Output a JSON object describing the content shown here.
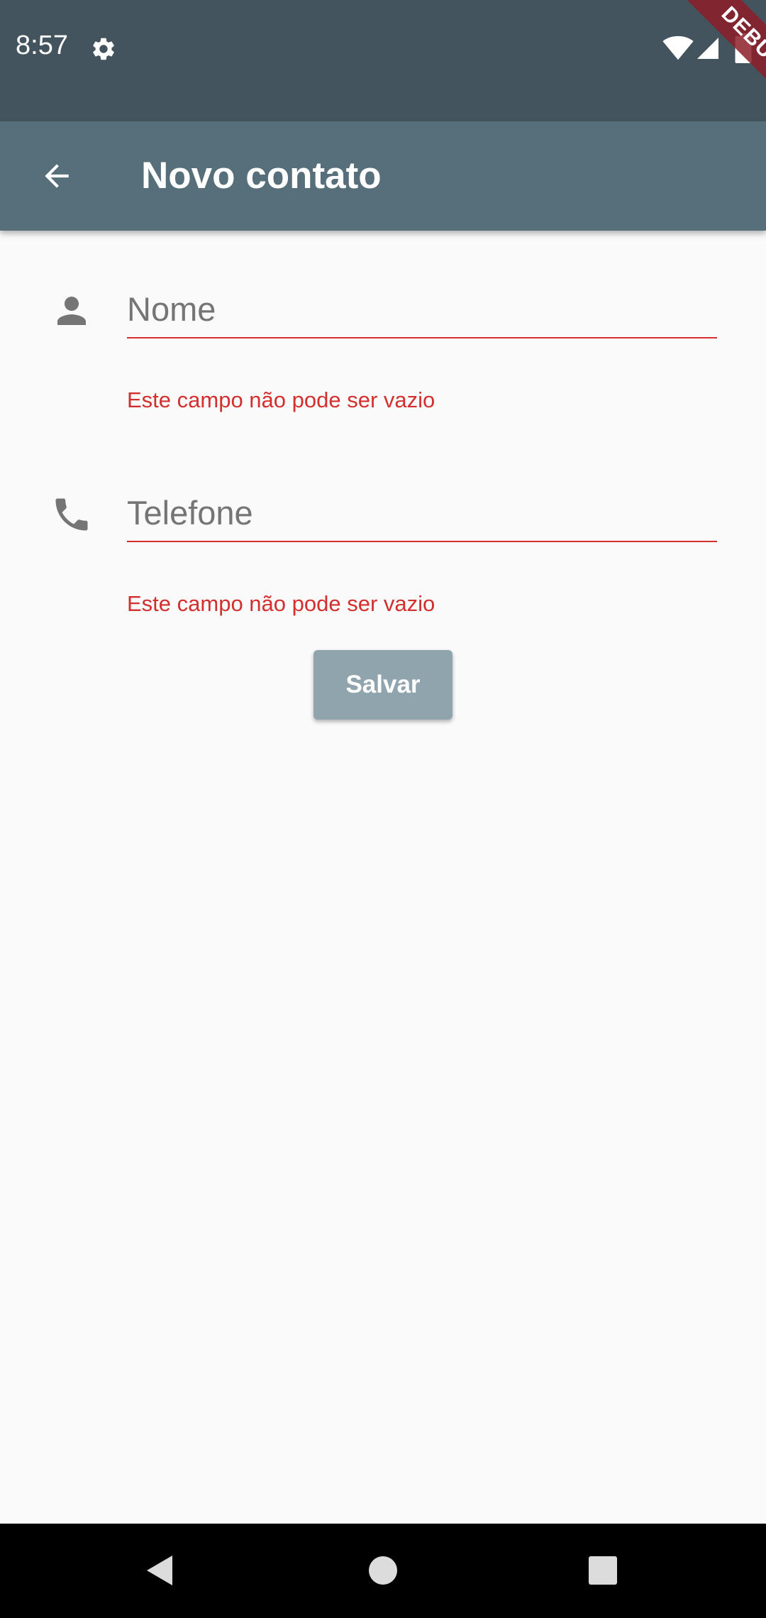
{
  "status_bar": {
    "time": "8:57",
    "icons": [
      "gear-icon",
      "wifi-icon",
      "signal-icon",
      "battery-icon"
    ],
    "debug_banner": "DEBUG"
  },
  "app_bar": {
    "title": "Novo contato",
    "back_icon": "arrow-back-icon"
  },
  "form": {
    "name_field": {
      "icon": "person-icon",
      "placeholder": "Nome",
      "value": "",
      "error": "Este campo não pode ser vazio"
    },
    "phone_field": {
      "icon": "phone-icon",
      "placeholder": "Telefone",
      "value": "",
      "error": "Este campo não pode ser vazio"
    },
    "save_label": "Salvar"
  },
  "nav_bar": {
    "buttons": [
      "back-triangle-icon",
      "home-circle-icon",
      "recents-square-icon"
    ]
  },
  "colors": {
    "status_bar": "#43545e",
    "app_bar": "#566f7b",
    "error": "#d32f2f",
    "button": "#90a4ae",
    "background": "#fafafa"
  }
}
